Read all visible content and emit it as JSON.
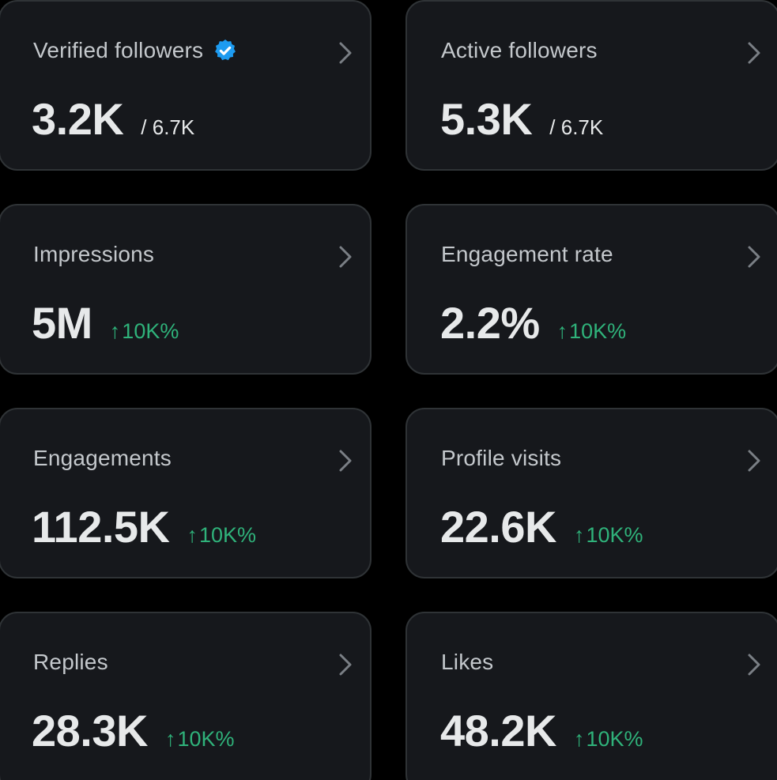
{
  "colors": {
    "background": "#000000",
    "card": "#16181c",
    "card_border": "#2f3336",
    "title_text": "#c4c8cc",
    "value_text": "#e7e9ea",
    "positive_change": "#2fb27a",
    "verified_badge": "#1d9bf0"
  },
  "icons": {
    "verified": "verified-badge-icon",
    "chevron": "chevron-right-icon",
    "arrow_up": "arrow-up-icon"
  },
  "cards": [
    {
      "title": "Verified followers",
      "value": "3.2K",
      "sub": "/ 6.7K",
      "verified": true
    },
    {
      "title": "Active followers",
      "value": "5.3K",
      "sub": "/ 6.7K"
    },
    {
      "title": "Impressions",
      "value": "5M",
      "change_arrow": "↑",
      "change": "10K%"
    },
    {
      "title": "Engagement rate",
      "value": "2.2%",
      "change_arrow": "↑",
      "change": "10K%"
    },
    {
      "title": "Engagements",
      "value": "112.5K",
      "change_arrow": "↑",
      "change": "10K%"
    },
    {
      "title": "Profile visits",
      "value": "22.6K",
      "change_arrow": "↑",
      "change": "10K%"
    },
    {
      "title": "Replies",
      "value": "28.3K",
      "change_arrow": "↑",
      "change": "10K%"
    },
    {
      "title": "Likes",
      "value": "48.2K",
      "change_arrow": "↑",
      "change": "10K%"
    }
  ]
}
